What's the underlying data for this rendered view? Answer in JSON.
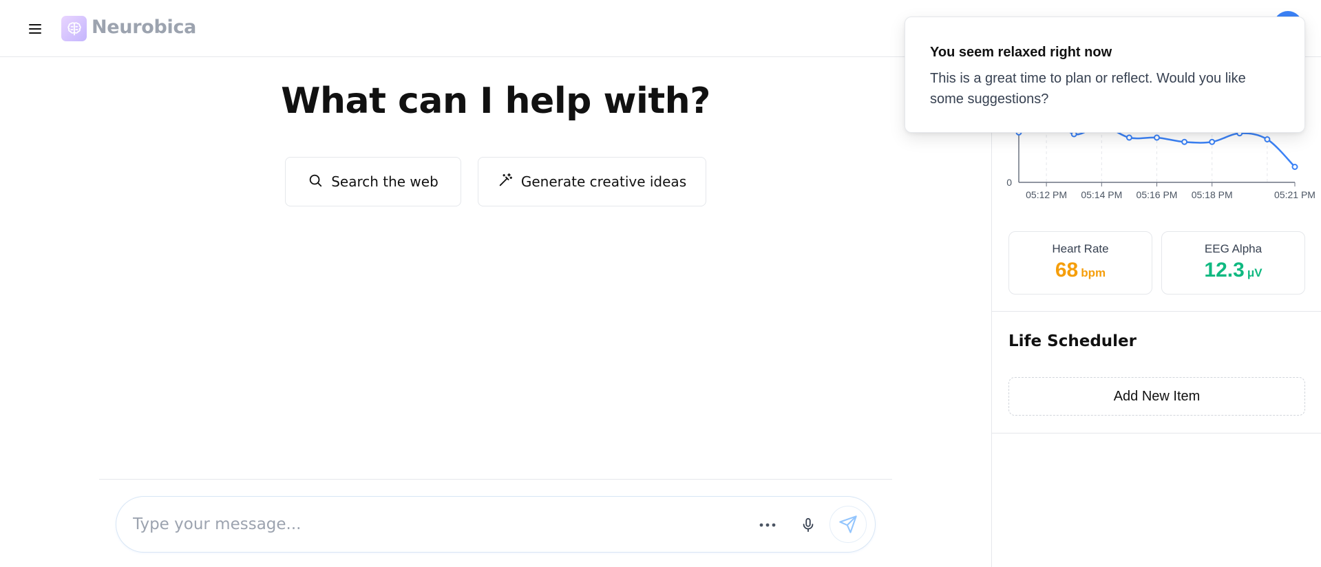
{
  "header": {
    "brand": "Neurobica",
    "icons": {
      "menu": "hamburger-menu-icon",
      "logo": "brain-icon",
      "avatar": "user-avatar"
    }
  },
  "main": {
    "title": "What can I help with?",
    "quick_actions": [
      {
        "label": "Search the web",
        "icon": "search-icon"
      },
      {
        "label": "Generate creative ideas",
        "icon": "magic-wand-icon"
      }
    ],
    "composer": {
      "placeholder": "Type your message...",
      "icons": {
        "more": "more-dots-icon",
        "mic": "microphone-icon",
        "send": "send-icon"
      }
    }
  },
  "sidebar": {
    "chart_data": {
      "type": "line",
      "x_tick_labels": [
        "05:12 PM",
        "05:14 PM",
        "05:16 PM",
        "05:18 PM",
        "05:21 PM"
      ],
      "y_tick_labels": [
        "0"
      ],
      "series": [
        {
          "values": [
            0.58,
            0.82,
            0.56,
            0.66,
            0.52,
            0.52,
            0.47,
            0.47,
            0.57,
            0.5,
            0.18
          ]
        }
      ],
      "color": "#3b82f6",
      "grid": "vertical dashed"
    },
    "metrics": {
      "heart_rate": {
        "label": "Heart Rate",
        "value": "68",
        "unit": "bpm",
        "color": "#f59e0b"
      },
      "eeg_alpha": {
        "label": "EEG Alpha",
        "value": "12.3",
        "unit": "μV",
        "color": "#10b981"
      }
    },
    "scheduler": {
      "title": "Life Scheduler",
      "add_label": "Add New Item"
    }
  },
  "toast": {
    "title": "You seem relaxed right now",
    "body": "This is a great time to plan or reflect. Would you like some suggestions?"
  }
}
